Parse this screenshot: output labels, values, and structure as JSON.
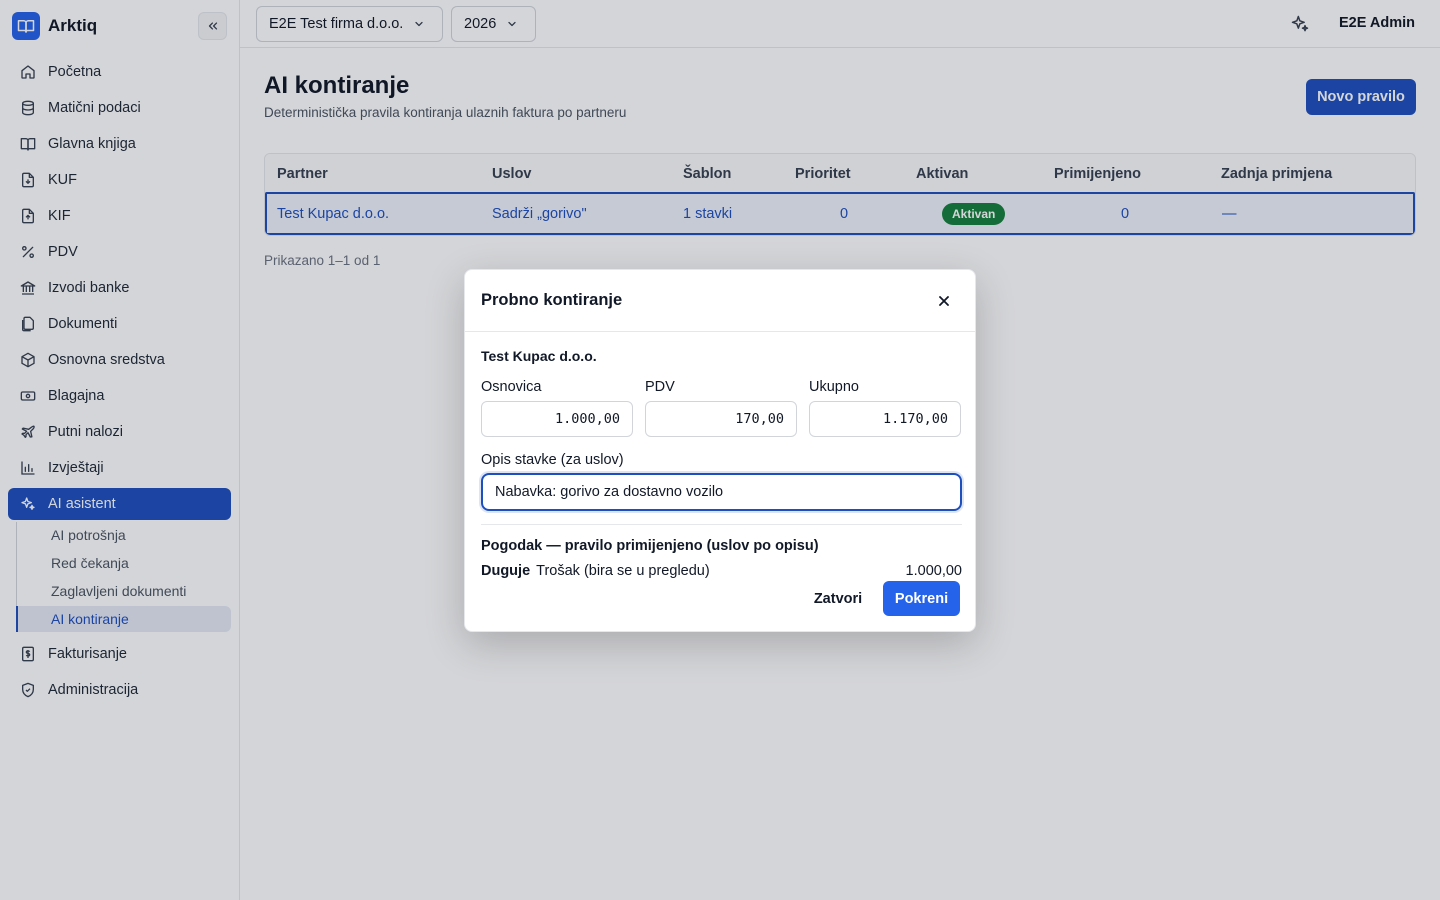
{
  "app": {
    "name": "Arktiq"
  },
  "sidebar": {
    "items": [
      {
        "label": "Početna",
        "icon": "home-icon"
      },
      {
        "label": "Matični podaci",
        "icon": "database-icon"
      },
      {
        "label": "Glavna knjiga",
        "icon": "book-icon"
      },
      {
        "label": "KUF",
        "icon": "document-in-icon"
      },
      {
        "label": "KIF",
        "icon": "document-out-icon"
      },
      {
        "label": "PDV",
        "icon": "percent-icon"
      },
      {
        "label": "Izvodi banke",
        "icon": "bank-icon"
      },
      {
        "label": "Dokumenti",
        "icon": "files-icon"
      },
      {
        "label": "Osnovna sredstva",
        "icon": "box-icon"
      },
      {
        "label": "Blagajna",
        "icon": "cash-icon"
      },
      {
        "label": "Putni nalozi",
        "icon": "plane-icon"
      },
      {
        "label": "Izvještaji",
        "icon": "bar-chart-icon"
      },
      {
        "label": "AI asistent",
        "icon": "sparkles-icon"
      }
    ],
    "ai_subitems": [
      "AI potrošnja",
      "Red čekanja",
      "Zaglavljeni dokumenti",
      "AI kontiranje"
    ],
    "bottom_items": [
      {
        "label": "Fakturisanje",
        "icon": "dollar-file-icon"
      },
      {
        "label": "Administracija",
        "icon": "shield-icon"
      }
    ]
  },
  "topbar": {
    "company": "E2E Test firma d.o.o.",
    "year": "2026",
    "user": "E2E Admin"
  },
  "page": {
    "title": "AI kontiranje",
    "subtitle": "Deterministička pravila kontiranja ulaznih faktura po partneru",
    "new_rule_label": "Novo pravilo"
  },
  "table": {
    "headers": [
      "Partner",
      "Uslov",
      "Šablon",
      "Prioritet",
      "Aktivan",
      "Primijenjeno",
      "Zadnja primjena"
    ],
    "rows": [
      {
        "partner": "Test Kupac d.o.o.",
        "condition": "Sadrži „gorivo\"",
        "template": "1 stavki",
        "priority": "0",
        "active": "Aktivan",
        "applied": "0",
        "last_applied": "—"
      }
    ],
    "footer": "Prikazano 1–1 od 1"
  },
  "modal": {
    "title": "Probno kontiranje",
    "partner": "Test Kupac d.o.o.",
    "base_label": "Osnovica",
    "base_value": "1.000,00",
    "vat_label": "PDV",
    "vat_value": "170,00",
    "total_label": "Ukupno",
    "total_value": "1.170,00",
    "desc_label": "Opis stavke (za uslov)",
    "desc_value": "Nabavka: gorivo za dostavno vozilo",
    "result_title": "Pogodak — pravilo primijenjeno (uslov po opisu)",
    "debit_label": "Duguje",
    "debit_account": "Trošak (bira se u pregledu)",
    "debit_amount": "1.000,00",
    "close_label": "Zatvori",
    "run_label": "Pokreni"
  },
  "colors": {
    "primary": "#1e4fbf",
    "accent_button": "#2563eb",
    "success": "#15803d"
  }
}
